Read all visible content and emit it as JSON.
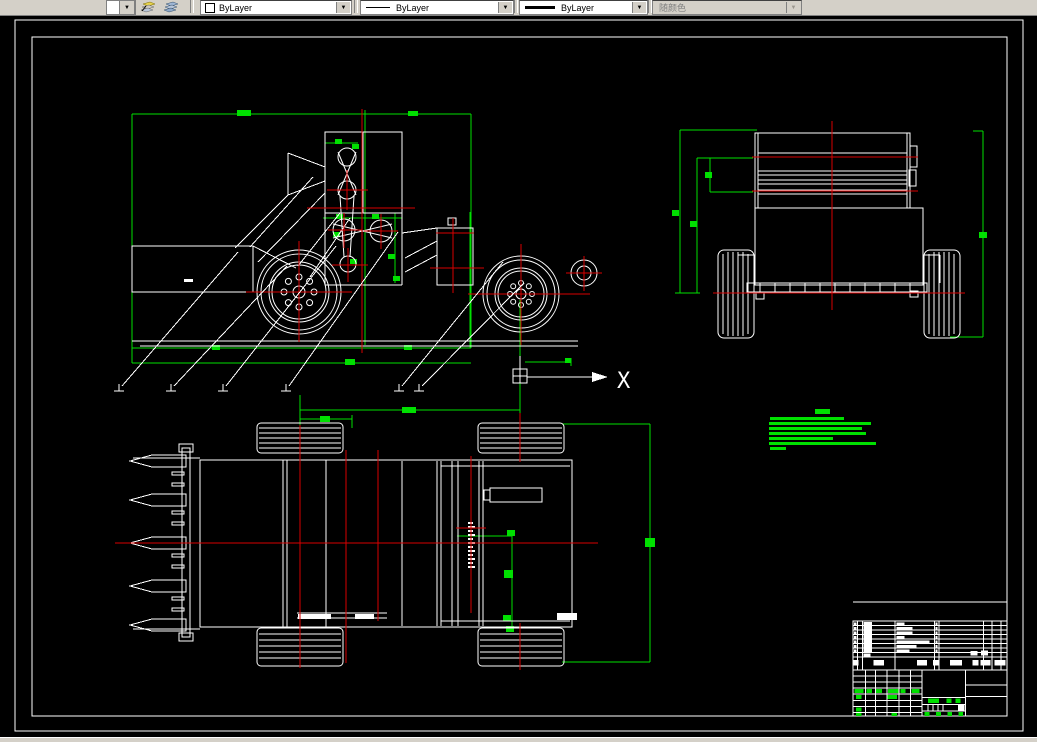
{
  "toolbar": {
    "dropdown_glyph": "▼",
    "layer_tools": [
      {
        "icon": "make-object-layer-current-icon"
      },
      {
        "icon": "layer-previous-icon"
      }
    ],
    "color_control": {
      "value": "ByLayer"
    },
    "linetype_control": {
      "value": "ByLayer"
    },
    "lineweight_control": {
      "value": "ByLayer"
    },
    "plot_style_control": {
      "value": "随颜色",
      "disabled": true
    }
  },
  "drawing": {
    "axis_label": "X",
    "colors": {
      "background": "#000000",
      "geometry": "#ffffff",
      "dimensions": "#00e000",
      "centerlines": "#d90000",
      "toolbar_bg": "#d4d0c8"
    },
    "views": [
      "side-elevation",
      "front",
      "top-plan"
    ],
    "balloon_leader_count": 6,
    "notes_block_lines": 8,
    "title_block": {
      "bom_rows": 7,
      "header_cells": 8
    }
  }
}
